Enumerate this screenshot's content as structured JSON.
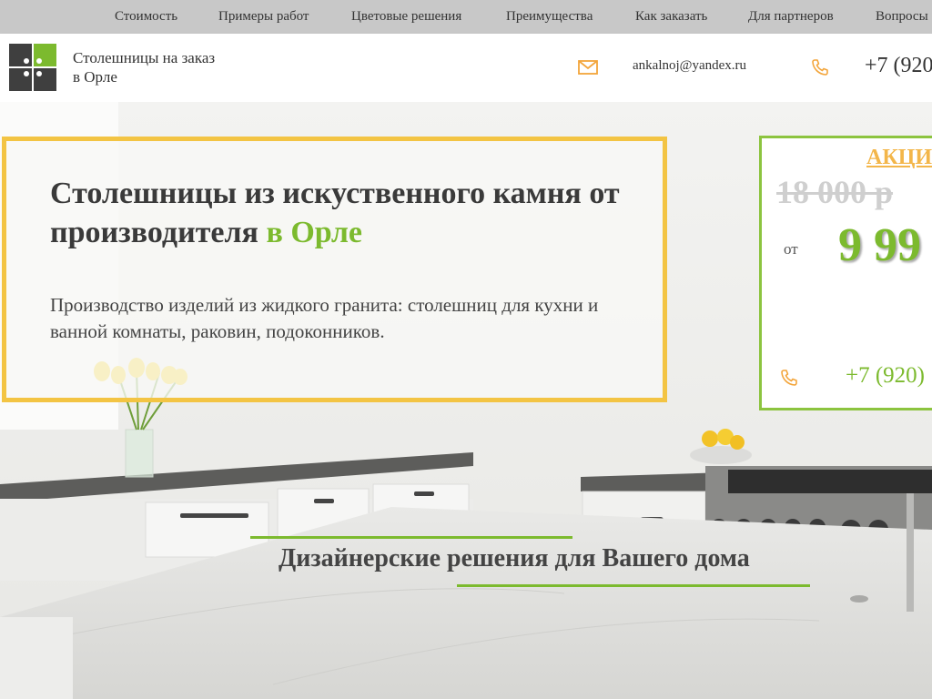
{
  "nav": {
    "items": [
      {
        "label": "Стоимость"
      },
      {
        "label": "Примеры работ"
      },
      {
        "label": "Цветовые решения"
      },
      {
        "label": "Преимущества"
      },
      {
        "label": "Как заказать"
      },
      {
        "label": "Для партнеров"
      },
      {
        "label": "Вопросы"
      }
    ]
  },
  "header": {
    "brand_line1": "Столешницы на заказ",
    "brand_line2": "в Орле",
    "email": "ankalnoj@yandex.ru",
    "phone": "+7 (920"
  },
  "hero": {
    "title_main": "Столешницы из искуственного камня от производителя",
    "title_accent": "в Орле",
    "description": "Производство изделий из жидкого гранита: столешниц для кухни и ванной комнаты, раковин, подоконников.",
    "section_title": "Дизайнерские решения для Вашего дома"
  },
  "promo": {
    "title": "АКЦИ",
    "old_price": "18 000 р",
    "from_label": "от",
    "new_price": "9 99",
    "phone": "+7 (920)"
  },
  "colors": {
    "accent_green": "#7cba2e",
    "frame_yellow": "#f3c443",
    "promo_orange": "#f3b64a",
    "nav_bg": "#c8c8c8"
  },
  "icons": {
    "logo": "logo-squares-icon",
    "mail": "mail-icon",
    "phone": "phone-icon"
  }
}
